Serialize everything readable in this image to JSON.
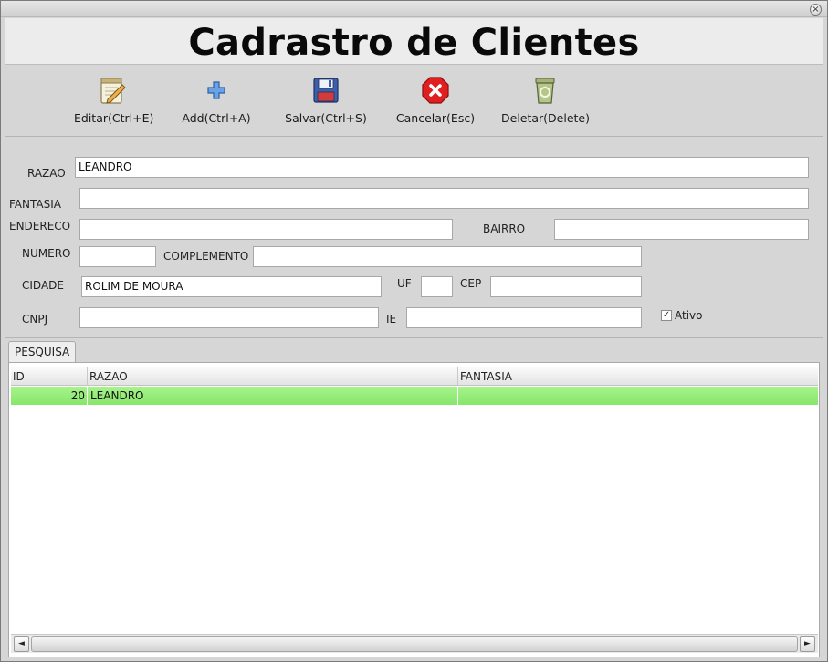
{
  "window": {
    "close_glyph": "×"
  },
  "header": {
    "title": "Cadrastro de Clientes"
  },
  "toolbar": {
    "edit_label": "Editar(Ctrl+E)",
    "add_label": "Add(Ctrl+A)",
    "save_label": "Salvar(Ctrl+S)",
    "cancel_label": "Cancelar(Esc)",
    "delete_label": "Deletar(Delete)"
  },
  "form": {
    "razao": {
      "label": "RAZAO",
      "value": "LEANDRO"
    },
    "fantasia": {
      "label": "FANTASIA",
      "value": ""
    },
    "endereco": {
      "label": "ENDERECO",
      "value": ""
    },
    "bairro": {
      "label": "BAIRRO",
      "value": ""
    },
    "numero": {
      "label": "NUMERO",
      "value": ""
    },
    "complemento": {
      "label": "COMPLEMENTO",
      "value": ""
    },
    "cidade": {
      "label": "CIDADE",
      "value": "ROLIM DE MOURA"
    },
    "uf": {
      "label": "UF",
      "value": ""
    },
    "cep": {
      "label": "CEP",
      "value": ""
    },
    "cnpj": {
      "label": "CNPJ",
      "value": ""
    },
    "ie": {
      "label": "IE",
      "value": ""
    },
    "ativo": {
      "label": "Ativo",
      "checked": true,
      "mark": "✓"
    }
  },
  "tabs": {
    "pesquisa_label": "PESQUISA"
  },
  "table": {
    "columns": [
      "ID",
      "RAZAO",
      "FANTASIA"
    ],
    "rows": [
      {
        "id": "20",
        "razao": "LEANDRO",
        "fantasia": ""
      }
    ]
  },
  "scrollbar": {
    "left_arrow": "◄",
    "right_arrow": "►"
  },
  "colors": {
    "selected_row": "#98ee7b",
    "cancel_icon": "#e02020",
    "add_icon": "#4a86d8"
  }
}
